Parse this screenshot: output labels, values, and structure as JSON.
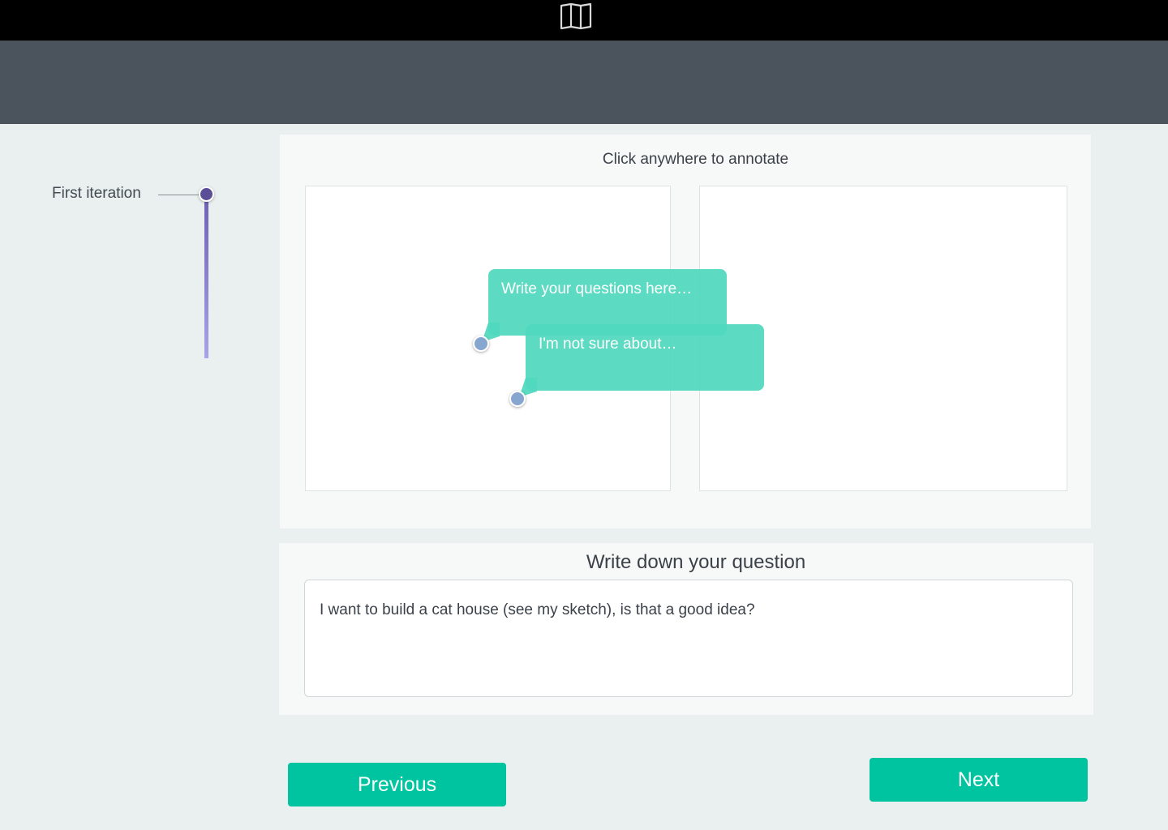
{
  "header": {
    "logo_icon": "book-map-icon"
  },
  "timeline": {
    "label": "First iteration",
    "accent": "#5a4f97"
  },
  "annotate": {
    "title": "Click anywhere to annotate",
    "annotations": [
      {
        "text": "Write your questions here…"
      },
      {
        "text": "I'm not sure about…"
      }
    ],
    "bubble_color": "#50d8bd",
    "pin_color": "#87a6cf"
  },
  "question": {
    "title": "Write down your question",
    "value": "I want to build a cat house (see my sketch), is that a good idea?"
  },
  "nav": {
    "previous_label": "Previous",
    "next_label": "Next",
    "button_color": "#00c4a0"
  }
}
